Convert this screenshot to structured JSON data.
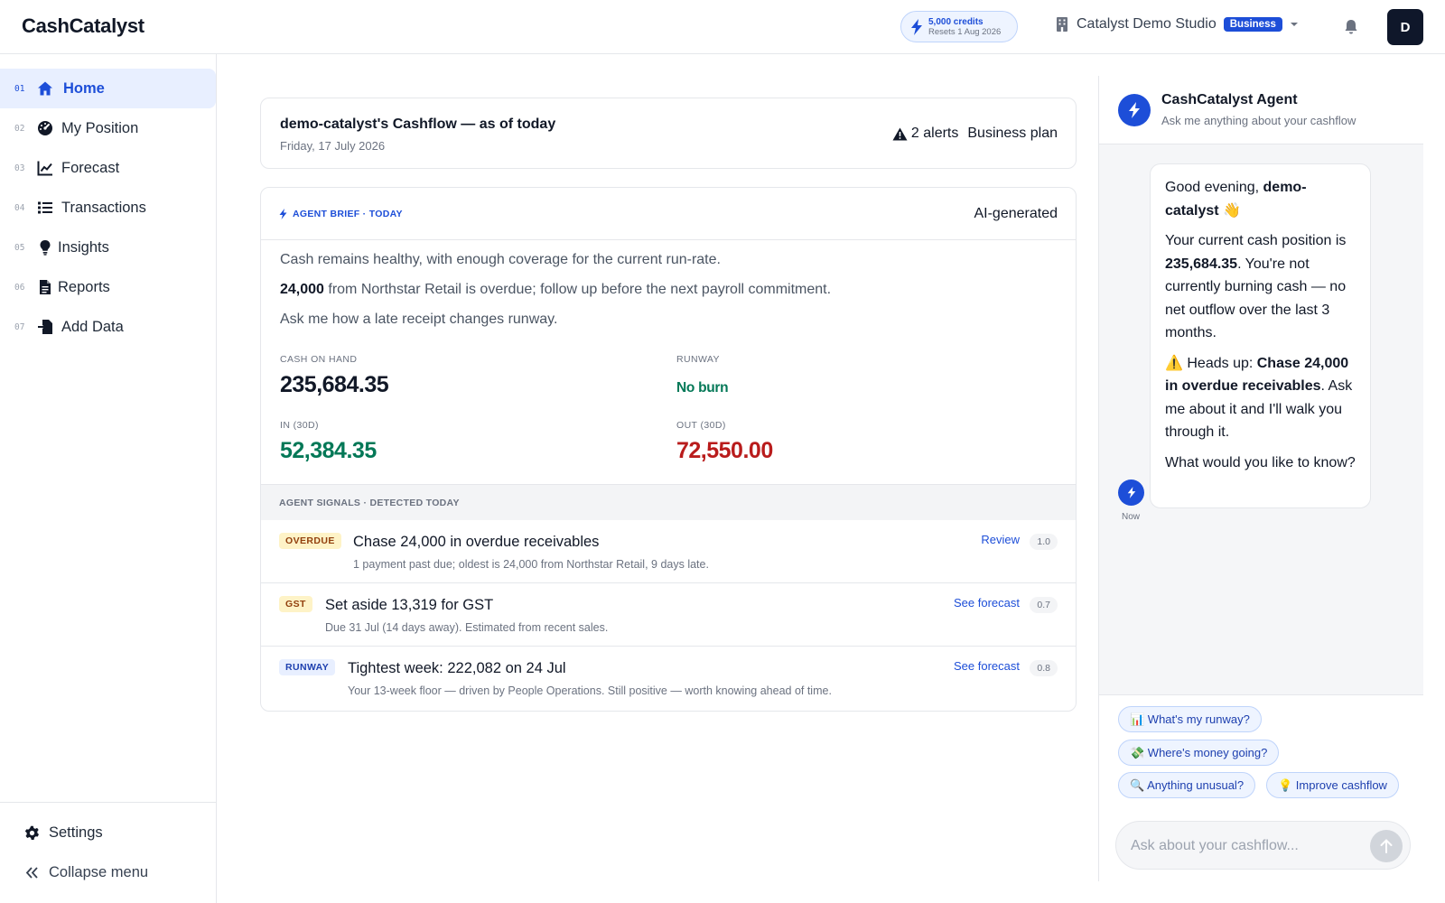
{
  "app": {
    "name": "CashCatalyst"
  },
  "credits": {
    "amount": "5,000 credits",
    "resets": "Resets 1 Aug 2026"
  },
  "org": {
    "name": "Catalyst Demo Studio",
    "plan_badge": "Business"
  },
  "user": {
    "initial": "D"
  },
  "sidebar": {
    "items": [
      {
        "num": "01",
        "label": "Home",
        "icon": "home-icon"
      },
      {
        "num": "02",
        "label": "My Position",
        "icon": "gauge-icon"
      },
      {
        "num": "03",
        "label": "Forecast",
        "icon": "line-chart-icon"
      },
      {
        "num": "04",
        "label": "Transactions",
        "icon": "list-icon"
      },
      {
        "num": "05",
        "label": "Insights",
        "icon": "lightbulb-icon"
      },
      {
        "num": "06",
        "label": "Reports",
        "icon": "document-icon"
      },
      {
        "num": "07",
        "label": "Add Data",
        "icon": "file-import-icon"
      }
    ],
    "settings_label": "Settings",
    "collapse_label": "Collapse menu"
  },
  "main": {
    "title": "demo-catalyst's Cashflow — as of today",
    "date": "Friday, 17 July 2026",
    "alerts": "2 alerts",
    "plan": "Business plan",
    "brief": {
      "tag": "AGENT BRIEF · TODAY",
      "badge": "AI-generated",
      "line1": "Cash remains healthy, with enough coverage for the current run-rate.",
      "line2_strong": "24,000",
      "line2_rest": " from Northstar Retail is overdue; follow up before the next payroll commitment.",
      "line3": "Ask me how a late receipt changes runway."
    },
    "metrics": {
      "cash_label": "CASH ON HAND",
      "cash_value": "235,684.35",
      "runway_label": "RUNWAY",
      "runway_value": "No burn",
      "in_label": "IN (30D)",
      "in_value": "52,384.35",
      "out_label": "OUT (30D)",
      "out_value": "72,550.00"
    },
    "signals_header": "AGENT SIGNALS · DETECTED TODAY",
    "signals": [
      {
        "badge": "OVERDUE",
        "title": "Chase 24,000 in overdue receivables",
        "desc": "1 payment past due; oldest is 24,000 from Northstar Retail, 9 days late.",
        "action": "Review",
        "score": "1.0"
      },
      {
        "badge": "GST",
        "title": "Set aside 13,319 for GST",
        "desc": "Due 31 Jul (14 days away). Estimated from recent sales.",
        "action": "See forecast",
        "score": "0.7"
      },
      {
        "badge": "RUNWAY",
        "title": "Tightest week: 222,082 on 24 Jul",
        "desc": "Your 13-week floor — driven by People Operations. Still positive — worth knowing ahead of time.",
        "action": "See forecast",
        "score": "0.8"
      }
    ]
  },
  "agent": {
    "title": "CashCatalyst Agent",
    "subtitle": "Ask me anything about your cashflow",
    "message": {
      "greeting": "Good evening, ",
      "greeting_name": "demo-catalyst",
      "greeting_emoji": " 👋",
      "p2_a": "Your current cash position is ",
      "p2_amount": "235,684.35",
      "p2_b": ". You're not currently burning cash — no net outflow over the last 3 months.",
      "p3_a": "⚠️ Heads up: ",
      "p3_strong": "Chase 24,000 in overdue receivables",
      "p3_b": ". Ask me about it and I'll walk you through it.",
      "p4": "What would you like to know?"
    },
    "time": "Now",
    "chips": [
      "📊 What's my runway?",
      "💸 Where's money going?",
      "🔍 Anything unusual?",
      "💡 Improve cashflow"
    ],
    "input_placeholder": "Ask about your cashflow..."
  }
}
